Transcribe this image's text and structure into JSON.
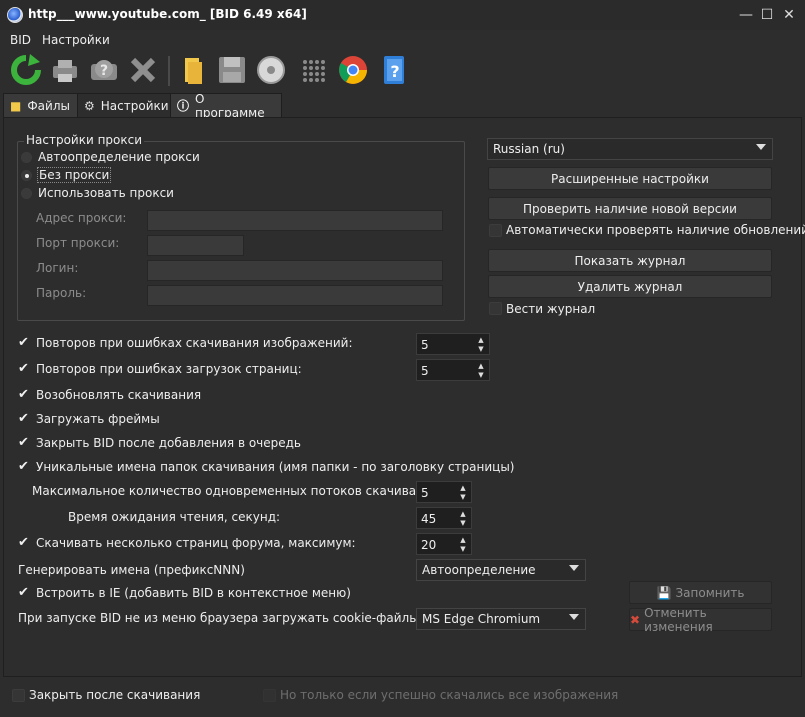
{
  "window": {
    "title": "http___www.youtube.com_ [BID 6.49 x64]"
  },
  "menu": {
    "items": [
      "BID",
      "Настройки"
    ]
  },
  "toolbar": {
    "icons": [
      "refresh-icon",
      "printer-icon",
      "help-disk-icon",
      "delete-icon",
      "folder-icon",
      "save-icon",
      "disc-icon",
      "grid-icon",
      "chrome-icon",
      "help-book-icon"
    ]
  },
  "tabs": [
    {
      "label": "Файлы",
      "icon": "folder-icon"
    },
    {
      "label": "Настройки",
      "icon": "gear-icon"
    },
    {
      "label": "О программе",
      "icon": "info-icon"
    }
  ],
  "proxy": {
    "legend": "Настройки прокси",
    "options": [
      "Автоопределение прокси",
      "Без прокси",
      "Использовать прокси"
    ],
    "selected_index": 1,
    "fields": {
      "address_label": "Адрес прокси:",
      "port_label": "Порт прокси:",
      "login_label": "Логин:",
      "password_label": "Пароль:"
    }
  },
  "right": {
    "language": "Russian (ru)",
    "advanced_settings": "Расширенные настройки",
    "check_version": "Проверить наличие новой версии",
    "auto_check_updates": "Автоматически проверять наличие обновлений",
    "auto_check_updates_checked": false,
    "show_log": "Показать журнал",
    "delete_log": "Удалить журнал",
    "keep_log": "Вести журнал",
    "keep_log_checked": false
  },
  "settings": {
    "img_retries_label": "Повторов при ошибках скачивания изображений:",
    "img_retries": "5",
    "page_retries_label": "Повторов при ошибках загрузок страниц:",
    "page_retries": "5",
    "resume": "Возобновлять скачивания",
    "frames": "Загружать фреймы",
    "close_after_queue": "Закрыть BID после добавления в очередь",
    "unique_names": "Уникальные имена папок скачивания (имя папки - по заголовку страницы)",
    "max_threads_label": "Максимальное количество одновременных потоков скачивания:",
    "max_threads": "5",
    "read_timeout_label": "Время ожидания чтения, секунд:",
    "read_timeout": "45",
    "forum_pages_label": "Скачивать несколько страниц форума, максимум:",
    "forum_pages": "20",
    "gen_names_label": "Генерировать имена (префиксNNN)",
    "gen_names_value": "Автоопределение",
    "ie_integration": "Встроить в IE (добавить BID в контекстное меню)",
    "cookies_label": "При запуске BID не из меню браузера загружать cookie-файлы из:",
    "cookies_value": "MS Edge Chromium",
    "save_button": "Запомнить",
    "cancel_button": "Отменить изменения"
  },
  "bottom": {
    "close_after_download": "Закрыть после скачивания",
    "only_if_success": "Но только если успешно скачались все изображения"
  }
}
